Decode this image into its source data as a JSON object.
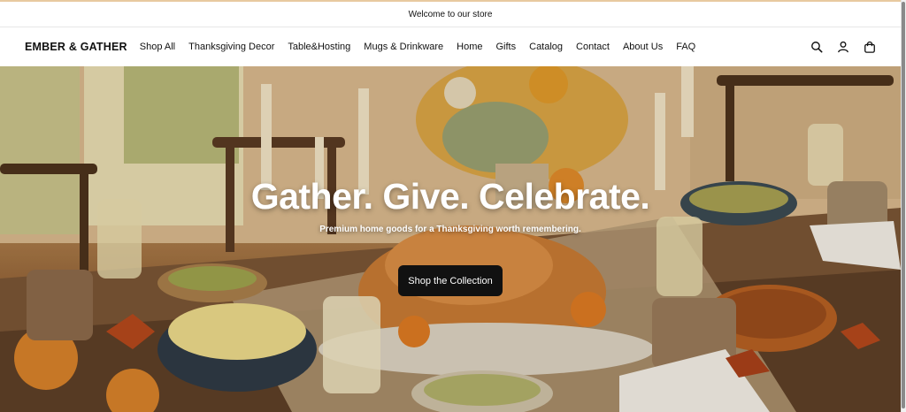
{
  "announcement": {
    "text": "Welcome to our store"
  },
  "header": {
    "logo": "EMBER & GATHER",
    "nav": [
      {
        "label": "Shop All"
      },
      {
        "label": "Thanksgiving Decor"
      },
      {
        "label": "Table&Hosting"
      },
      {
        "label": "Mugs & Drinkware"
      },
      {
        "label": "Home"
      },
      {
        "label": "Gifts"
      },
      {
        "label": "Catalog"
      },
      {
        "label": "Contact"
      },
      {
        "label": "About Us"
      },
      {
        "label": "FAQ"
      }
    ],
    "icons": [
      "search-icon",
      "account-icon",
      "cart-bag-icon"
    ]
  },
  "hero": {
    "title": "Gather. Give. Celebrate.",
    "subtitle": "Premium home goods for a Thanksgiving worth remembering.",
    "button_label": "Shop the Collection"
  },
  "colors": {
    "accent_bar": "#e8c9a0",
    "button_bg": "#111111",
    "text": "#111111"
  }
}
